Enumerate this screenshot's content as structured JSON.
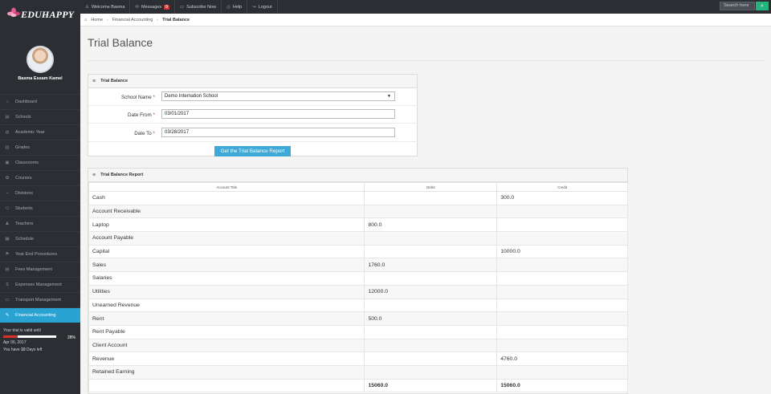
{
  "app": {
    "logo": "EDUHAPPY"
  },
  "topnav": {
    "welcome": "Welcome Basma",
    "messages": "Messages",
    "messages_count": "0",
    "subscribe": "Subscribe Now",
    "help": "Help",
    "logout": "Logout",
    "search_placeholder": "Search here"
  },
  "breadcrumb": {
    "home": "Home",
    "parent": "Financial Accounting",
    "current": "Trial Balance"
  },
  "page": {
    "title": "Trial Balance"
  },
  "user": {
    "name": "Basma Essam Kamel"
  },
  "sidebar": {
    "items": [
      {
        "label": "Dashboard",
        "icon": "home-icon"
      },
      {
        "label": "Schools",
        "icon": "building-icon"
      },
      {
        "label": "Academic Year",
        "icon": "globe-icon"
      },
      {
        "label": "Grades",
        "icon": "bars-icon"
      },
      {
        "label": "Classrooms",
        "icon": "board-icon"
      },
      {
        "label": "Courses",
        "icon": "gear-icon"
      },
      {
        "label": "Divisions",
        "icon": "divide-icon"
      },
      {
        "label": "Students",
        "icon": "users-icon"
      },
      {
        "label": "Teachers",
        "icon": "teacher-icon"
      },
      {
        "label": "Schedule",
        "icon": "calendar-icon"
      },
      {
        "label": "Year End Procedures",
        "icon": "flag-icon"
      },
      {
        "label": "Fees Management",
        "icon": "money-icon"
      },
      {
        "label": "Expenses Management",
        "icon": "dollar-icon"
      },
      {
        "label": "Transport Management",
        "icon": "bus-icon"
      },
      {
        "label": "Financial Accounting",
        "icon": "ledger-icon",
        "active": true
      }
    ],
    "trial": {
      "text": "Your trial is valid until",
      "percent_label": "28%",
      "percent": 28,
      "date": "Apr 06, 2017",
      "days_prefix": "You have",
      "days": "10",
      "days_suffix": "Days left"
    }
  },
  "form": {
    "panel_title": "Trial Balance",
    "school_label": "School Name",
    "school_value": "Demo Internation School",
    "from_label": "Date From",
    "from_value": "03/01/2017",
    "to_label": "Date To",
    "to_value": "03/28/2017",
    "required_mark": "*",
    "submit": "Get the Trial Balance Report"
  },
  "report": {
    "panel_title": "Trial Balance Report",
    "columns": [
      "Account Title",
      "Debit",
      "Credit"
    ],
    "rows": [
      [
        "Cash",
        "",
        "300.0"
      ],
      [
        "Account Receivable",
        "",
        ""
      ],
      [
        "Laptop",
        "800.0",
        ""
      ],
      [
        "Account Payable",
        "",
        ""
      ],
      [
        "Capital",
        "",
        "10000.0"
      ],
      [
        "Sales",
        "1760.0",
        ""
      ],
      [
        "Salaries",
        "",
        ""
      ],
      [
        "Utilities",
        "12000.0",
        ""
      ],
      [
        "Unearned Revenue",
        "",
        ""
      ],
      [
        "Rent",
        "500.0",
        ""
      ],
      [
        "Rent Payable",
        "",
        ""
      ],
      [
        "Client Account",
        "",
        ""
      ],
      [
        "Revenue",
        "",
        "4760.0"
      ],
      [
        "Retained Earning",
        "",
        ""
      ]
    ],
    "total": [
      "",
      "15060.0",
      "15060.0"
    ]
  }
}
